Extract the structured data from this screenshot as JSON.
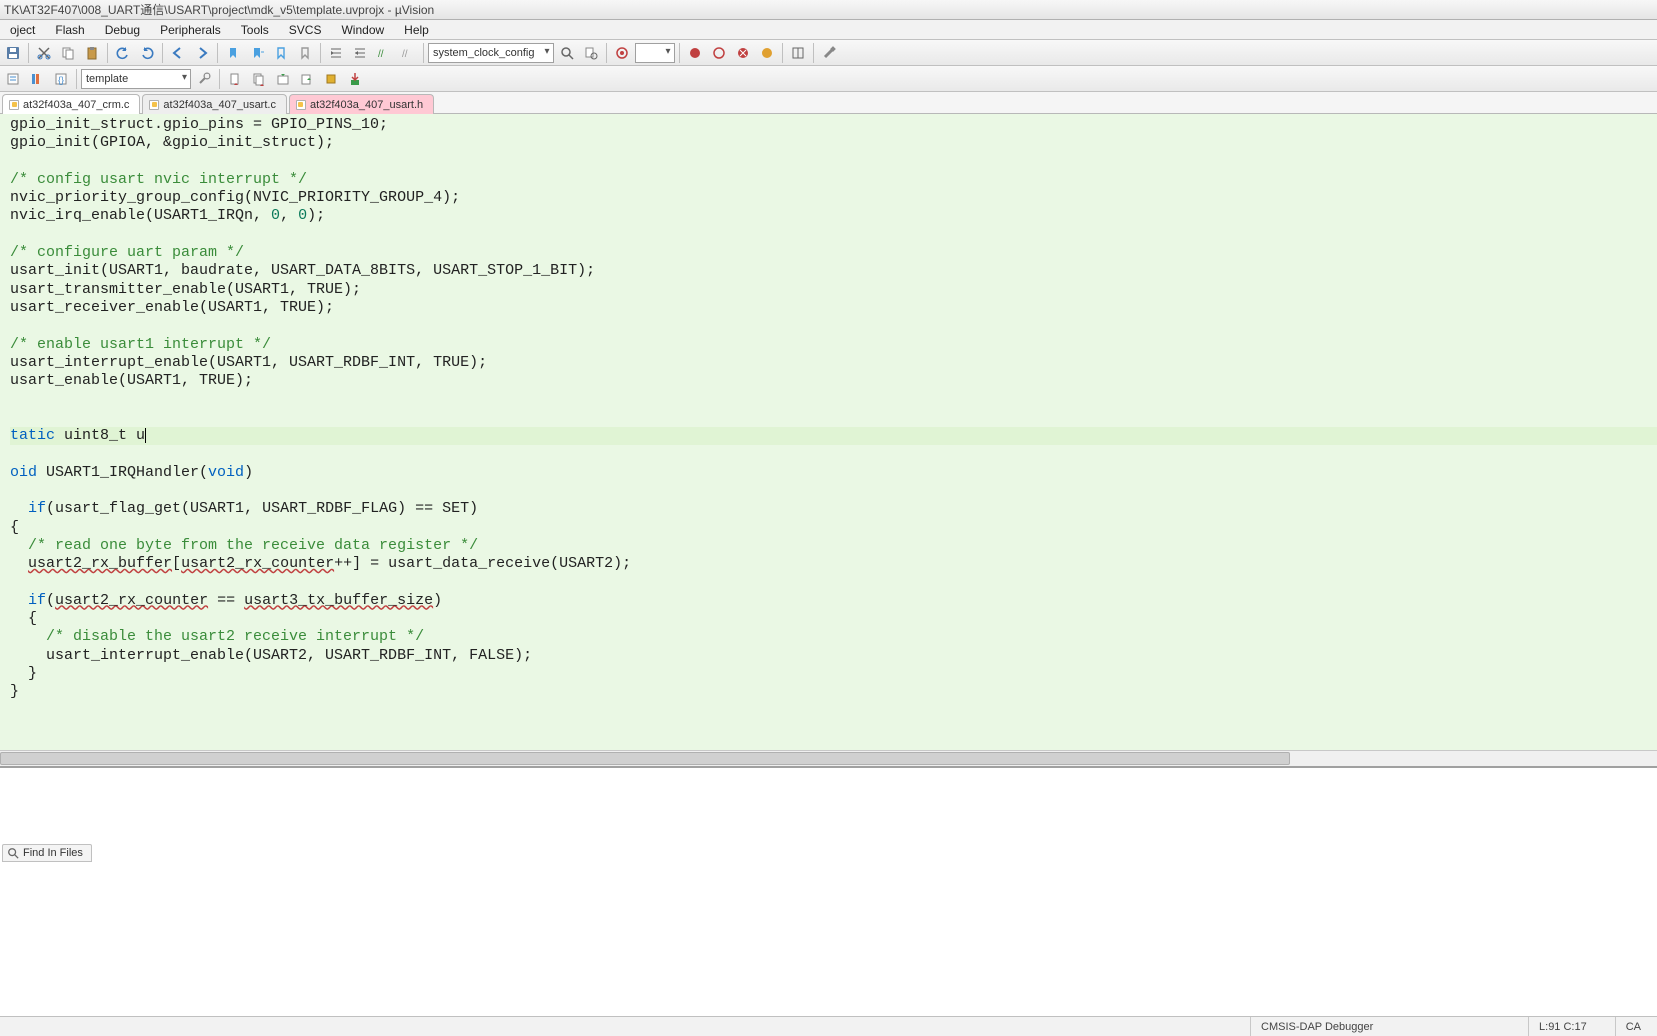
{
  "title": "TK\\AT32F407\\008_UART通信\\USART\\project\\mdk_v5\\template.uvprojx - µVision",
  "menu": [
    "oject",
    "Flash",
    "Debug",
    "Peripherals",
    "Tools",
    "SVCS",
    "Window",
    "Help"
  ],
  "toolbar1": {
    "config_combo": "system_clock_config"
  },
  "toolbar2": {
    "target_combo": "template"
  },
  "tabs": [
    {
      "label": "at32f403a_407_crm.c",
      "state": "active"
    },
    {
      "label": "at32f403a_407_usart.c",
      "state": "normal"
    },
    {
      "label": "at32f403a_407_usart.h",
      "state": "modified"
    }
  ],
  "code": {
    "lines": [
      {
        "t": "gpio_init_struct.gpio_pins = GPIO_PINS_10;"
      },
      {
        "t": "gpio_init(GPIOA, &gpio_init_struct);"
      },
      {
        "t": ""
      },
      {
        "t": "/* config usart nvic interrupt */",
        "cls": "cmt"
      },
      {
        "t": "nvic_priority_group_config(NVIC_PRIORITY_GROUP_4);"
      },
      {
        "t_pre": "nvic_irq_enable(USART1_IRQn, ",
        "nums": [
          "0",
          "0"
        ],
        "t_post": ");"
      },
      {
        "t": ""
      },
      {
        "t": "/* configure uart param */",
        "cls": "cmt"
      },
      {
        "t": "usart_init(USART1, baudrate, USART_DATA_8BITS, USART_STOP_1_BIT);"
      },
      {
        "t": "usart_transmitter_enable(USART1, TRUE);"
      },
      {
        "t": "usart_receiver_enable(USART1, TRUE);"
      },
      {
        "t": ""
      },
      {
        "t": "/* enable usart1 interrupt */",
        "cls": "cmt"
      },
      {
        "t": "usart_interrupt_enable(USART1, USART_RDBF_INT, TRUE);"
      },
      {
        "t": "usart_enable(USART1, TRUE);"
      },
      {
        "t": ""
      },
      {
        "t": ""
      },
      {
        "cursor": true,
        "kw": "tatic",
        "rest": " uint8_t u"
      },
      {
        "t": ""
      },
      {
        "kw": "oid",
        "mid": " USART1_IRQHandler(",
        "kw2": "void",
        "end": ")"
      },
      {
        "t": ""
      },
      {
        "kw3": "if",
        "rest": "(usart_flag_get(USART1, USART_RDBF_FLAG) == SET)"
      },
      {
        "t": "{"
      },
      {
        "t": "  /* read one byte from the receive data register */",
        "cls": "cmt"
      },
      {
        "pre": "  ",
        "err1": "usart2_rx_buffer",
        "mid": "[",
        "err2": "usart2_rx_counter",
        "post": "++] = usart_data_receive(USART2);"
      },
      {
        "t": ""
      },
      {
        "kw3": "if",
        "pre": "(",
        "err1": "usart2_rx_counter",
        "mid": " == ",
        "err2": "usart3_tx_buffer_size",
        "post": ")"
      },
      {
        "t": "  {"
      },
      {
        "t": "    /* disable the usart2 receive interrupt */",
        "cls": "cmt"
      },
      {
        "t": "    usart_interrupt_enable(USART2, USART_RDBF_INT, FALSE);"
      },
      {
        "t": "  }"
      },
      {
        "t": "}"
      }
    ]
  },
  "find_tab": "Find In Files",
  "status": {
    "debugger": "CMSIS-DAP Debugger",
    "pos": "L:91 C:17",
    "caps": "CA"
  }
}
